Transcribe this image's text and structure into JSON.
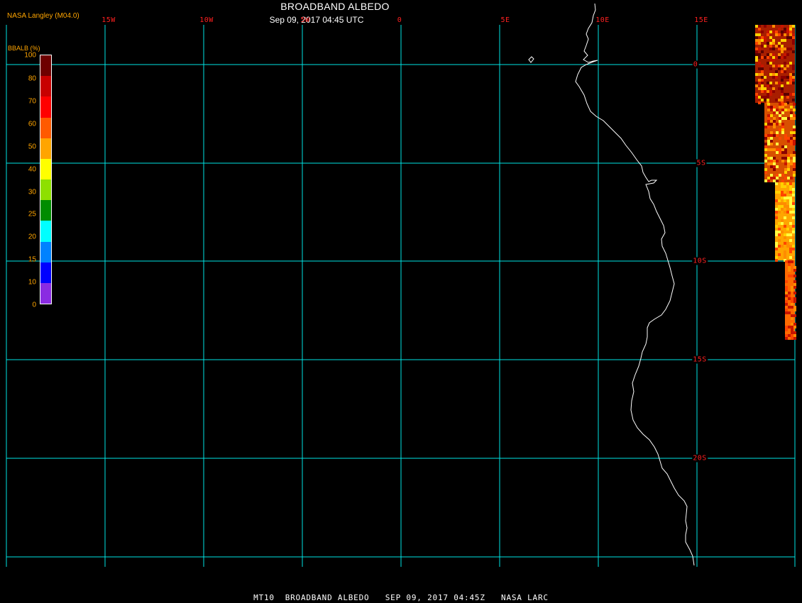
{
  "header": {
    "title": "BROADBAND ALBEDO",
    "subtitle": "Sep 09, 2017 04:45 UTC",
    "producer": "NASA Langley (M04.0)"
  },
  "map": {
    "grid_color": "#00e5e5",
    "label_color": "#ff2020",
    "coast_color": "#ffffff",
    "lon_labels": [
      "15W",
      "10W",
      "5W",
      "0",
      "5E",
      "10E",
      "15E"
    ],
    "lat_labels": [
      "0",
      "5S",
      "10S",
      "15S",
      "20S"
    ]
  },
  "colorbar": {
    "title": "BBALB (%)",
    "ticks": [
      "100",
      "80",
      "70",
      "60",
      "50",
      "40",
      "30",
      "25",
      "20",
      "15",
      "10",
      "0"
    ],
    "colors": [
      "#6e0000",
      "#c80000",
      "#ff0000",
      "#ff5a00",
      "#ffa500",
      "#ffff00",
      "#8ee000",
      "#008c00",
      "#00ffff",
      "#0082ff",
      "#0000ff",
      "#8a2be2"
    ],
    "text_color": "#ffa500"
  },
  "footer": {
    "text": "MT10  BROADBAND ALBEDO   SEP 09, 2017 04:45Z   NASA LARC"
  }
}
